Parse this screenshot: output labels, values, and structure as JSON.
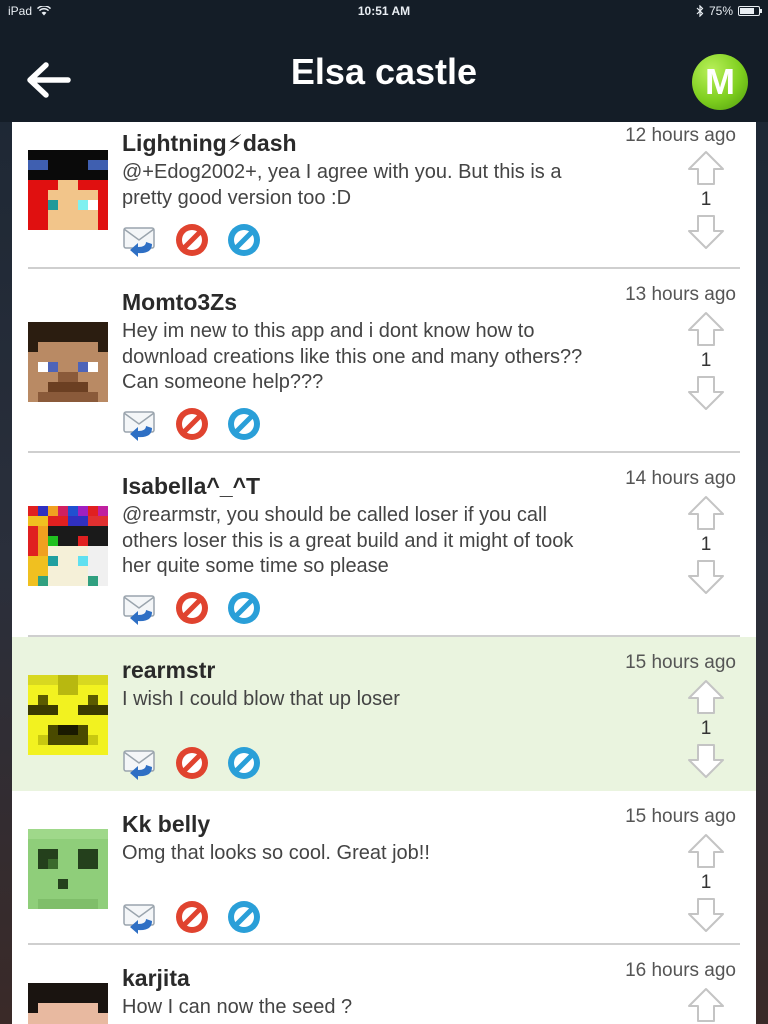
{
  "status_bar": {
    "device": "iPad",
    "time": "10:51 AM",
    "battery": "75%",
    "battery_level": 0.75
  },
  "header": {
    "title": "Elsa castle",
    "logo_letter": "M",
    "back_icon": "back-arrow-icon"
  },
  "comments": [
    {
      "username": "Lightning⚡dash",
      "time": "12 hours ago",
      "lines": [
        "@+Edog2002+, yea I agree with you. But this is a",
        "pretty good version too :D"
      ],
      "votes": "1"
    },
    {
      "username": "Momto3Zs",
      "time": "13 hours ago",
      "lines": [
        "Hey im new to this app and i dont know how to",
        "download creations like this one and many others??",
        "Can someone help???"
      ],
      "votes": "1"
    },
    {
      "username": "Isabella^_^T",
      "time": "14 hours ago",
      "lines": [
        "@rearmstr, you should be called loser if you call",
        "others loser this is a great build and it might of took",
        "her quite some time so please"
      ],
      "votes": "1"
    },
    {
      "username": "rearmstr",
      "time": "15 hours ago",
      "lines": [
        "I wish I could blow that up loser"
      ],
      "votes": "1"
    },
    {
      "username": "Kk belly",
      "time": "15 hours ago",
      "lines": [
        "Omg that looks so cool. Great job!!"
      ],
      "votes": "1"
    },
    {
      "username": "karjita",
      "time": "16 hours ago",
      "lines": [
        "How I can now the seed ?"
      ],
      "votes": ""
    }
  ],
  "colors": {
    "nav_background": "#141d27",
    "highlight_row": "#eaf4df",
    "logo_green": "#7fcf1f",
    "block_red": "#e0432f",
    "edit_blue": "#2a9fd8"
  }
}
